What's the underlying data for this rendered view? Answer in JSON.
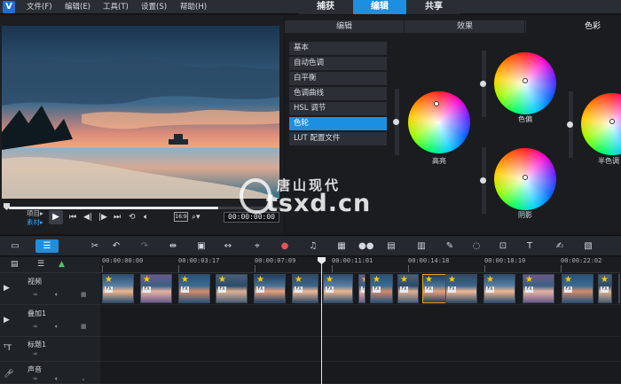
{
  "menu": {
    "items": [
      "文件(F)",
      "编辑(E)",
      "工具(T)",
      "设置(S)",
      "帮助(H)"
    ]
  },
  "mode_tabs": [
    {
      "label": "捕获",
      "active": false
    },
    {
      "label": "编辑",
      "active": true
    },
    {
      "label": "共享",
      "active": false
    }
  ],
  "preview": {
    "mode_project": "项目▸",
    "mode_clip": "素材▸",
    "timecode": "00:00:00:00",
    "ratio": "16:9",
    "scrub_fraction": 0.0
  },
  "edit_tabs": [
    {
      "label": "编辑",
      "active": false
    },
    {
      "label": "效果",
      "active": false
    },
    {
      "label": "色彩",
      "active": true
    }
  ],
  "color_list": [
    {
      "label": "基本",
      "active": false
    },
    {
      "label": "自动色调",
      "active": false
    },
    {
      "label": "白平衡",
      "active": false
    },
    {
      "label": "色调曲线",
      "active": false
    },
    {
      "label": "HSL 调节",
      "active": false
    },
    {
      "label": "色轮",
      "active": true
    },
    {
      "label": "LUT 配置文件",
      "active": false
    }
  ],
  "wheels": {
    "highlight": "高亮",
    "midtone": "色偏",
    "shadow": "阴影",
    "half": "半色调"
  },
  "watermark": {
    "brand": "唐山现代",
    "domain": "tsxd.cn"
  },
  "ruler": [
    "00:00:00:00",
    "00:00:03:17",
    "00:00:07:09",
    "00:00:11:01",
    "00:00:14:18",
    "00:00:18:10",
    "00:00:22:02"
  ],
  "tracks": [
    {
      "name": "视频",
      "icon": "video"
    },
    {
      "name": "叠加1",
      "icon": "overlay"
    },
    {
      "name": "标题1",
      "icon": "title"
    },
    {
      "name": "声音",
      "icon": "voice"
    }
  ],
  "clip_badge": "FX",
  "colors": {
    "accent": "#1d8fe0",
    "panel": "#1a1c20"
  }
}
